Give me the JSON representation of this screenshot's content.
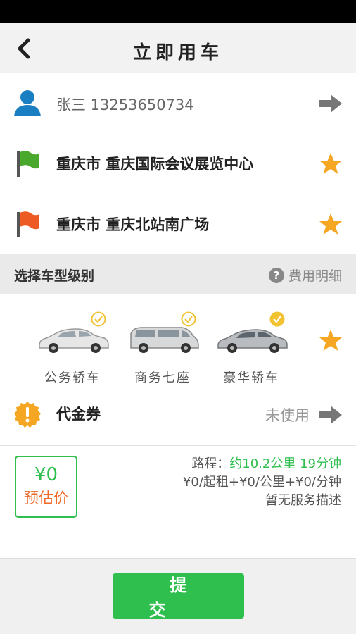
{
  "header": {
    "title": "立即用车"
  },
  "passenger": {
    "text": "张三 13253650734"
  },
  "start": {
    "text": "重庆市 重庆国际会议展览中心"
  },
  "end": {
    "text": "重庆市 重庆北站南广场"
  },
  "section": {
    "title": "选择车型级别",
    "fee_detail": "费用明细"
  },
  "cars": [
    {
      "label": "公务轿车",
      "selected": false
    },
    {
      "label": "商务七座",
      "selected": false
    },
    {
      "label": "豪华轿车",
      "selected": true
    }
  ],
  "voucher": {
    "label": "代金券",
    "status": "未使用"
  },
  "price": {
    "amount": "¥0",
    "estimate_label": "预估价"
  },
  "route": {
    "prefix": "路程：",
    "summary": "约10.2公里 19分钟",
    "rates": "¥0/起租+¥0/公里+¥0/分钟",
    "service": "暂无服务描述"
  },
  "submit_label": "提交",
  "colors": {
    "accent": "#2fbf4e",
    "orange": "#ee6a2b",
    "star": "#f5a623"
  }
}
